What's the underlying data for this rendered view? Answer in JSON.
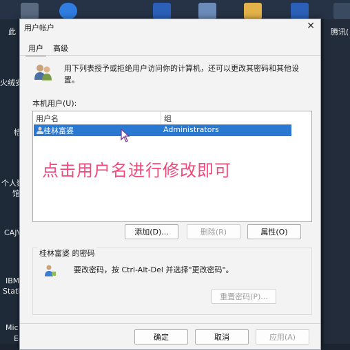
{
  "desktop": {
    "left_labels": [
      "此",
      "火绒安",
      "桔",
      "个人数",
      "馆",
      "CAJV",
      "IBM",
      "Statis",
      "Mic",
      "Ec"
    ],
    "right_label": "腾讯(",
    "icons": [
      "app-icon",
      "bluetooth-icon",
      "word-icon",
      "folder-icon",
      "word-icon",
      "app-icon"
    ]
  },
  "dialog": {
    "title": "用户帐户",
    "tabs": [
      "用户",
      "高级"
    ],
    "intro": "用下列表授予或拒绝用户访问你的计算机，还可以更改其密码和其他设置。",
    "list_label": "本机用户(U):",
    "columns": [
      "用户名",
      "组"
    ],
    "rows": [
      {
        "name": "桂林富婆",
        "group": "Administrators",
        "selected": true
      }
    ],
    "annotation": "点击用户名进行修改即可",
    "buttons": {
      "add": "添加(D)...",
      "remove": "删除(R)",
      "properties": "属性(O)",
      "reset_password": "重置密码(P)...",
      "ok": "确定",
      "cancel": "取消",
      "apply": "应用(A)"
    },
    "password_group_label": "桂林富婆 的密码",
    "password_hint": "要改密码，按 Ctrl-Alt-Del 并选择\"更改密码\"。",
    "close_symbol": "✕"
  },
  "colors": {
    "selection": "#2a78d1",
    "annotation": "#f2497a",
    "dialog_bg": "#f3f3f3"
  }
}
